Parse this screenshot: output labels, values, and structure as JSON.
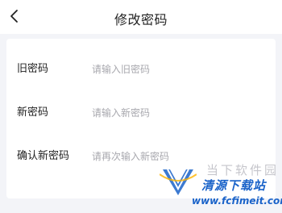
{
  "header": {
    "title": "修改密码",
    "back_icon": "chevron-left-icon"
  },
  "form": {
    "old_password": {
      "label": "旧密码",
      "placeholder": "请输入旧密码",
      "value": ""
    },
    "new_password": {
      "label": "新密码",
      "placeholder": "请输入新密码",
      "value": ""
    },
    "confirm_password": {
      "label": "确认新密码",
      "placeholder": "请再次输入新密码",
      "value": ""
    }
  },
  "watermark": {
    "site": "当下软件园",
    "brand": "清源下载站",
    "url": "www.fcfimeit.com",
    "brand_color": "#1a63c9"
  },
  "colors": {
    "background": "#f3f4f8",
    "card": "#ffffff",
    "placeholder": "#a8a8ae"
  }
}
